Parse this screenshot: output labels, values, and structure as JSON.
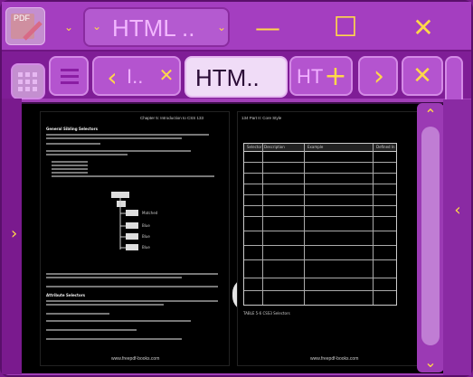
{
  "app": {
    "icon_label": "PDF"
  },
  "titlebar": {
    "tab_label": "HTML ..",
    "minimize": "—",
    "maximize": "☐",
    "close": "✕"
  },
  "toolbar": {
    "home_icon": "grid-icon",
    "menu_icon": "hamburger-icon",
    "prev_tab_label": "I..",
    "active_tab_label": "HTM..",
    "next_tab_label": "HT",
    "add_tab": "+",
    "close_tab": "✕",
    "nav_next": "›"
  },
  "document": {
    "left_page": {
      "header": "Chapter 5:  Introduction to CSS   133",
      "section1": "General Sibling Selectors",
      "section2": "Attribute Selectors",
      "footer": "www.freepdf-books.com"
    },
    "right_page": {
      "header": "134   Part II:  Core Style",
      "caption": "TABLE 5-6   CSS3 Selectors",
      "footer": "www.freepdf-books.com",
      "table_columns": [
        "Selector",
        "Description",
        "Example",
        "Defined In"
      ]
    }
  },
  "colors": {
    "frame": "#a23fb8",
    "accent": "#ffd84a",
    "active_tab": "#f0dcf7"
  }
}
